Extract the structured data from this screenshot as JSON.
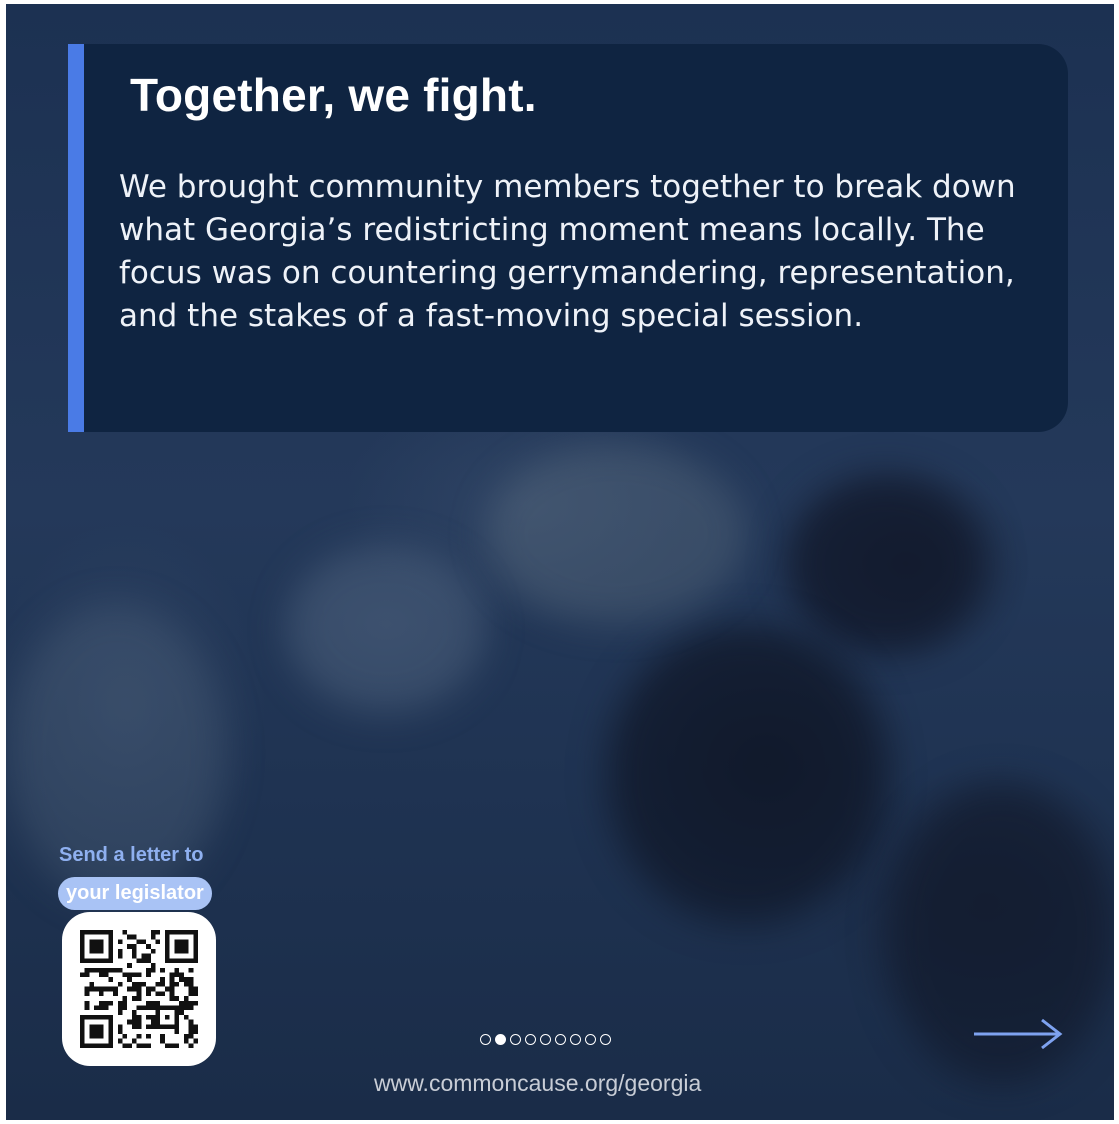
{
  "slide": {
    "headline": "Together, we fight.",
    "body": "We brought community members together to break down what Georgia’s redistricting moment means locally. The focus was on countering gerrymandering, representation, and the stakes of a fast-moving special session."
  },
  "cta": {
    "line1": "Send a letter to",
    "line2": "your legislator",
    "qr_icon": "qr-code-icon"
  },
  "carousel": {
    "total_slides": 9,
    "current_slide": 2
  },
  "footer": {
    "url": "www.commoncause.org/georgia"
  },
  "icons": {
    "next": "arrow-right-icon"
  },
  "colors": {
    "accent": "#4a7be6",
    "panel": "#0f2441",
    "cta_text": "#8fb0f0",
    "cta_pill": "#a9c3f5"
  }
}
